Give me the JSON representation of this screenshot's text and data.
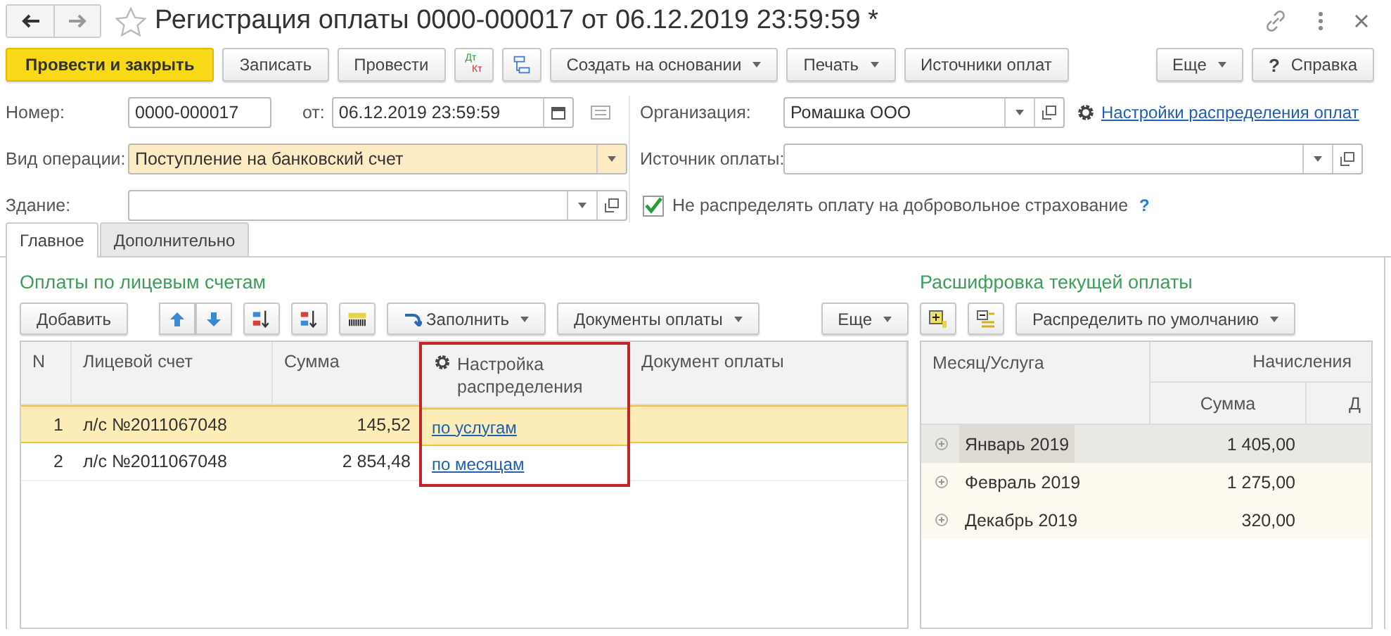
{
  "window": {
    "title": "Регистрация оплаты 0000-000017 от 06.12.2019 23:59:59 *"
  },
  "toolbar": {
    "buttons": [
      {
        "kind": "primary",
        "label": "Провести и закрыть"
      },
      {
        "kind": "button",
        "label": "Записать"
      },
      {
        "kind": "button",
        "label": "Провести"
      },
      {
        "kind": "dtkt",
        "top": "Дт",
        "bottom": "Кт"
      },
      {
        "kind": "structure"
      },
      {
        "kind": "menu",
        "label": "Создать на основании"
      },
      {
        "kind": "menu",
        "label": "Печать"
      },
      {
        "kind": "button",
        "label": "Источники оплат"
      }
    ],
    "right_buttons": [
      {
        "kind": "menu",
        "label": "Еще"
      },
      {
        "kind": "help",
        "mark": "?",
        "label": "Справка"
      }
    ]
  },
  "form": {
    "number": {
      "label": "Номер:",
      "value": "0000-000017"
    },
    "date": {
      "label": "от:",
      "value": "06.12.2019 23:59:59"
    },
    "operation": {
      "label": "Вид операции:",
      "value": "Поступление на банковский счет"
    },
    "building": {
      "label": "Здание:"
    },
    "organization": {
      "label": "Организация:",
      "value": "Ромашка ООО"
    },
    "settings_link": "Настройки распределения оплат",
    "source": {
      "label": "Источник оплаты:"
    },
    "checkbox": {
      "label": "Не распределять оплату на добровольное страхование",
      "checked": true,
      "help": "?"
    }
  },
  "tabs": [
    {
      "label": "Главное",
      "selected": true
    },
    {
      "label": "Дополнительно",
      "selected": false
    }
  ],
  "payments": {
    "title": "Оплаты по лицевым счетам",
    "add": "Добавить",
    "fill": "Заполнить",
    "documents": "Документы оплаты",
    "more": "Еще",
    "columns": [
      "N",
      "Лицевой счет",
      "Сумма",
      "Настройка распределения",
      "Документ оплаты"
    ],
    "rows": [
      {
        "n": "1",
        "account": "л/с №2011067048",
        "sum": "145,52",
        "setting": "по услугам",
        "selected": true
      },
      {
        "n": "2",
        "account": "л/с №2011067048",
        "sum": "2 854,48",
        "setting": "по месяцам",
        "selected": false
      }
    ]
  },
  "breakdown": {
    "title": "Расшифровка текущей оплаты",
    "distribute": "Распределить по умолчанию",
    "columns": {
      "month": "Месяц/Услуга",
      "group": "Начисления",
      "sum": "Сумма",
      "column_4": "Д"
    },
    "rows": [
      {
        "month": "Январь 2019",
        "sum": "1 405,00",
        "selected": true
      },
      {
        "month": "Февраль 2019",
        "sum": "1 275,00",
        "selected": false
      },
      {
        "month": "Декабрь 2019",
        "sum": "320,00",
        "selected": false
      }
    ]
  }
}
